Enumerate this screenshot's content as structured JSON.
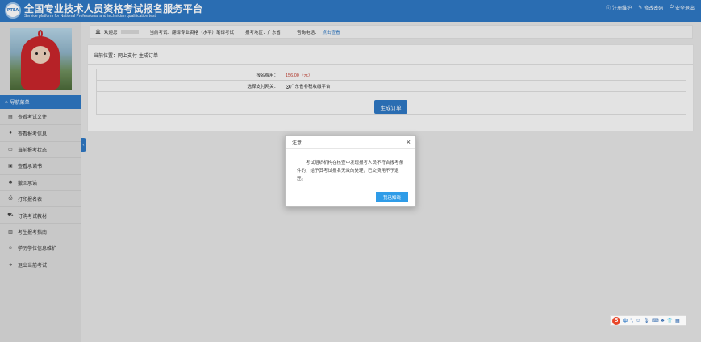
{
  "header": {
    "logo_text": "PTEA",
    "title_cn": "全国专业技术人员资格考试报名服务平台",
    "title_en": "Service platform for National Professional and technician qualification test",
    "links": [
      {
        "icon": "info-icon",
        "label": "注册维护"
      },
      {
        "icon": "edit-icon",
        "label": "修改密码"
      },
      {
        "icon": "power-icon",
        "label": "安全退出"
      }
    ]
  },
  "info_bar": {
    "welcome_label": "欢迎您",
    "exam_label": "当前考试：翻译专业资格（水平）笔译考试",
    "region_label": "报考地区：广东省",
    "phone_label": "咨询电话：",
    "phone_link": "点击查看"
  },
  "sidebar": {
    "nav_header": "导航菜单",
    "items": [
      {
        "icon": "document-icon",
        "label": "查看考试文件"
      },
      {
        "icon": "info-circle-icon",
        "label": "查看报考信息"
      },
      {
        "icon": "monitor-icon",
        "label": "当前报考状态"
      },
      {
        "icon": "certificate-icon",
        "label": "查看承诺书"
      },
      {
        "icon": "puzzle-icon",
        "label": "撤回承诺"
      },
      {
        "icon": "print-icon",
        "label": "打印报名表"
      },
      {
        "icon": "cart-icon",
        "label": "订购考试教材"
      },
      {
        "icon": "guide-icon",
        "label": "考生报考指南"
      },
      {
        "icon": "user-edit-icon",
        "label": "学历学位信息维护"
      },
      {
        "icon": "logout-icon",
        "label": "退出当前考试"
      }
    ]
  },
  "content": {
    "breadcrumb": "当前位置：网上支付-生成订单",
    "fee_label": "报名费用：",
    "fee_value": "156.00（元）",
    "gateway_label": "选择支付网关：",
    "gateway_option": "广东省非税收缴平台",
    "generate_button": "生成订单"
  },
  "modal": {
    "title": "注意",
    "close": "×",
    "message": "考试组织机构在核查中发现报考人员不符合报考条件的，给予其考试报名无效的处理，已交费用不予退还。",
    "confirm_button": "我已知晓"
  },
  "ime": {
    "logo": "S",
    "mode": "中",
    "icons": [
      "punct-icon",
      "emoji-icon",
      "mic-icon",
      "keyboard-icon",
      "skin-icon",
      "shirt-icon",
      "grid-icon"
    ]
  },
  "colors": {
    "header_bg": "#2f78c4",
    "fee_red": "#c0392b",
    "modal_button": "#2f9ce8"
  }
}
